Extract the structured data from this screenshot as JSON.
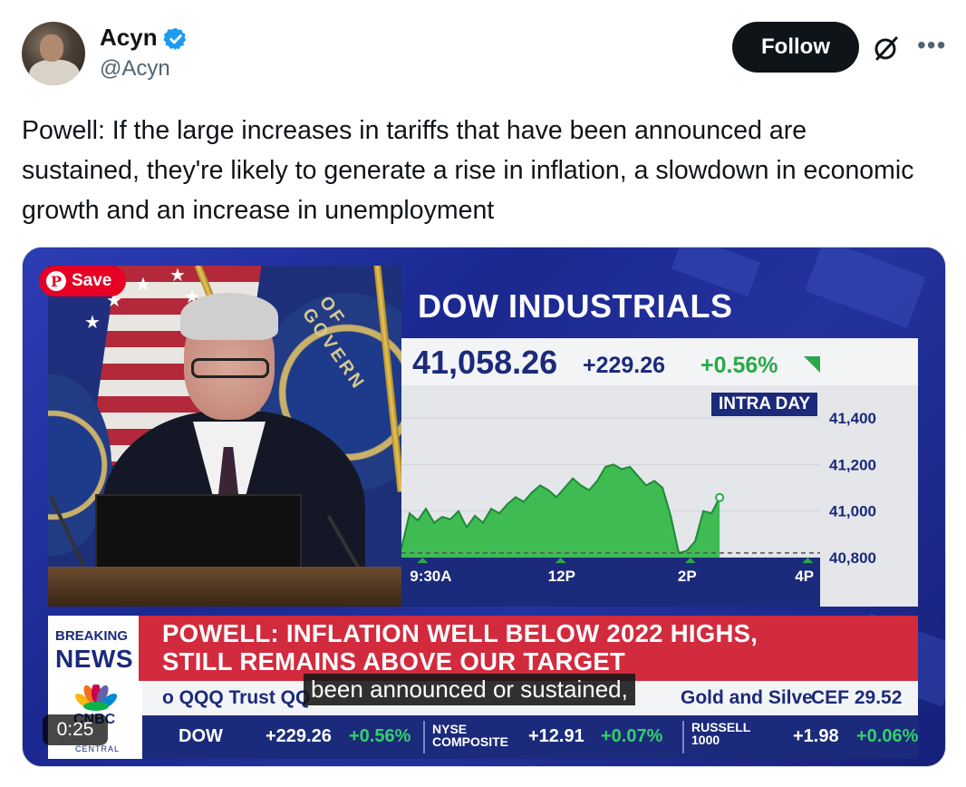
{
  "tweet": {
    "display_name": "Acyn",
    "handle": "@Acyn",
    "follow_label": "Follow",
    "text": "Powell: If the large increases in tariffs that have been announced are sustained, they're likely to generate a rise in inflation, a slowdown in economic growth and an increase in unemployment"
  },
  "icons": {
    "verified": "verified-badge-icon",
    "grok": "grok-icon",
    "more": "more-icon",
    "pinterest": "pinterest-icon"
  },
  "colors": {
    "verified_blue": "#1d9bf0",
    "follow_bg": "#0f1419",
    "cnbc_navy": "#1b2a7a",
    "up_green": "#2aa84a",
    "breaking_red": "#d22b3d",
    "pinterest_red": "#e60023"
  },
  "media": {
    "save_label": "Save",
    "timestamp": "0:25",
    "caption": "been announced or sustained,",
    "dow_title": "DOW INDUSTRIALS",
    "price": "41,058.26",
    "change": "+229.26",
    "change_pct": "+0.56%",
    "intraday_label": "INTRA DAY",
    "breaking_top": "BREAKING",
    "breaking_bottom": "NEWS",
    "headline_line1": "POWELL: INFLATION WELL BELOW 2022 HIGHS,",
    "headline_line2": "STILL REMAINS ABOVE OUR TARGET",
    "ticker_top": [
      "o QQQ Trust QQ",
      "Gold and Silve",
      "CEF 29.52"
    ],
    "ticker_bottom": {
      "dow_label": "DOW",
      "dow_change": "+229.26",
      "dow_pct": "+0.56%",
      "nyse_label_1": "NYSE",
      "nyse_label_2": "COMPOSITE",
      "nyse_change": "+12.91",
      "nyse_pct": "+0.07%",
      "russell_label_1": "RUSSELL",
      "russell_label_2": "1000",
      "russell_change": "+1.98",
      "russell_pct": "+0.06%"
    },
    "cnbc_logo": "CNBC",
    "cnbc_sub": "CENTRAL"
  },
  "chart_data": {
    "type": "area",
    "x_ticks": [
      "9:30A",
      "12P",
      "2P",
      "4P"
    ],
    "y_ticks": [
      "41,400",
      "41,200",
      "41,000",
      "40,800"
    ],
    "ylim": [
      40800,
      41400
    ],
    "series": [
      {
        "values": [
          40840,
          40990,
          40960,
          41010,
          40950,
          40975,
          40965,
          41000,
          40930,
          40980,
          40950,
          41010,
          40990,
          41030,
          41060,
          41040,
          41080,
          41110,
          41090,
          41060,
          41100,
          41140,
          41110,
          41090,
          41130,
          41190,
          41200,
          41180,
          41190,
          41150,
          41110,
          41130,
          41100,
          40980,
          40820,
          40830,
          40870,
          41000,
          40990,
          41058
        ]
      }
    ],
    "previous_close": 40820
  }
}
